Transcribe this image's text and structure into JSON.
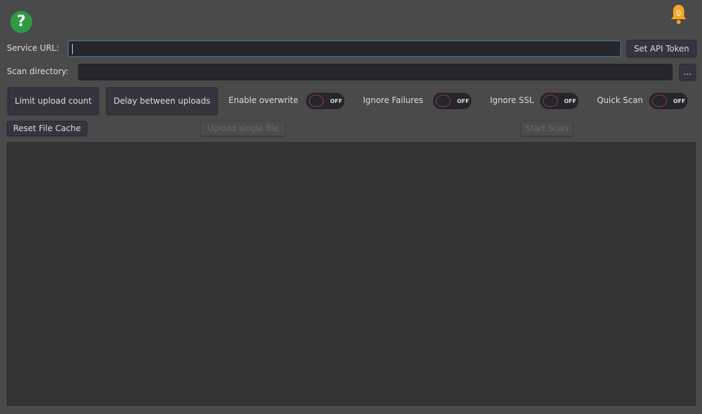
{
  "help": {
    "icon": "question-icon",
    "glyph": "?"
  },
  "notifications": {
    "count": "0",
    "color": "#f5a623"
  },
  "service_url": {
    "label": "Service URL:",
    "value": ""
  },
  "set_api_token": "Set API Token",
  "scan_directory": {
    "label": "Scan directory:",
    "value": "",
    "browse": "..."
  },
  "limit_upload": "Limit upload count",
  "delay_uploads": "Delay between uploads",
  "toggles": [
    {
      "label": "Enable overwrite",
      "state": "OFF"
    },
    {
      "label": "Ignore Failures",
      "state": "OFF"
    },
    {
      "label": "Ignore SSL",
      "state": "OFF"
    },
    {
      "label": "Quick Scan",
      "state": "OFF"
    }
  ],
  "reset_cache": "Reset File Cache",
  "upload_single": "Upload single file",
  "start_scan": "Start Scan"
}
